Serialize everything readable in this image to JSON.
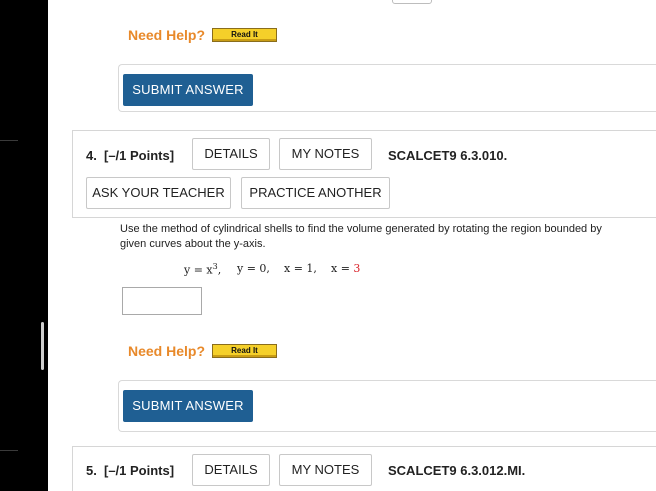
{
  "help": {
    "label": "Need Help?",
    "read_it": "Read It"
  },
  "submit_label": "SUBMIT ANSWER",
  "question4": {
    "number": "4.",
    "points": "[–/1 Points]",
    "details": "DETAILS",
    "my_notes": "MY NOTES",
    "code": "SCALCET9 6.3.010.",
    "ask_teacher": "ASK YOUR TEACHER",
    "practice_another": "PRACTICE ANOTHER",
    "text_line1": "Use the method of cylindrical shells to find the volume generated by rotating the region bounded by",
    "text_line2": "given curves about the y-axis.",
    "eq1_base": "y = x",
    "eq1_exp": "3",
    "eq2": "y = 0,",
    "eq3": "x = 1,",
    "eq4_lhs": "x =",
    "eq4_value": "3",
    "answer_value": ""
  },
  "question5": {
    "number": "5.",
    "points": "[–/1 Points]",
    "details": "DETAILS",
    "my_notes": "MY NOTES",
    "code": "SCALCET9 6.3.012.MI."
  },
  "colors": {
    "help": "#e8892a",
    "read_it_bg": "#f5d02a",
    "submit_bg": "#1f5f93",
    "highlight_value": "#d9232a"
  }
}
